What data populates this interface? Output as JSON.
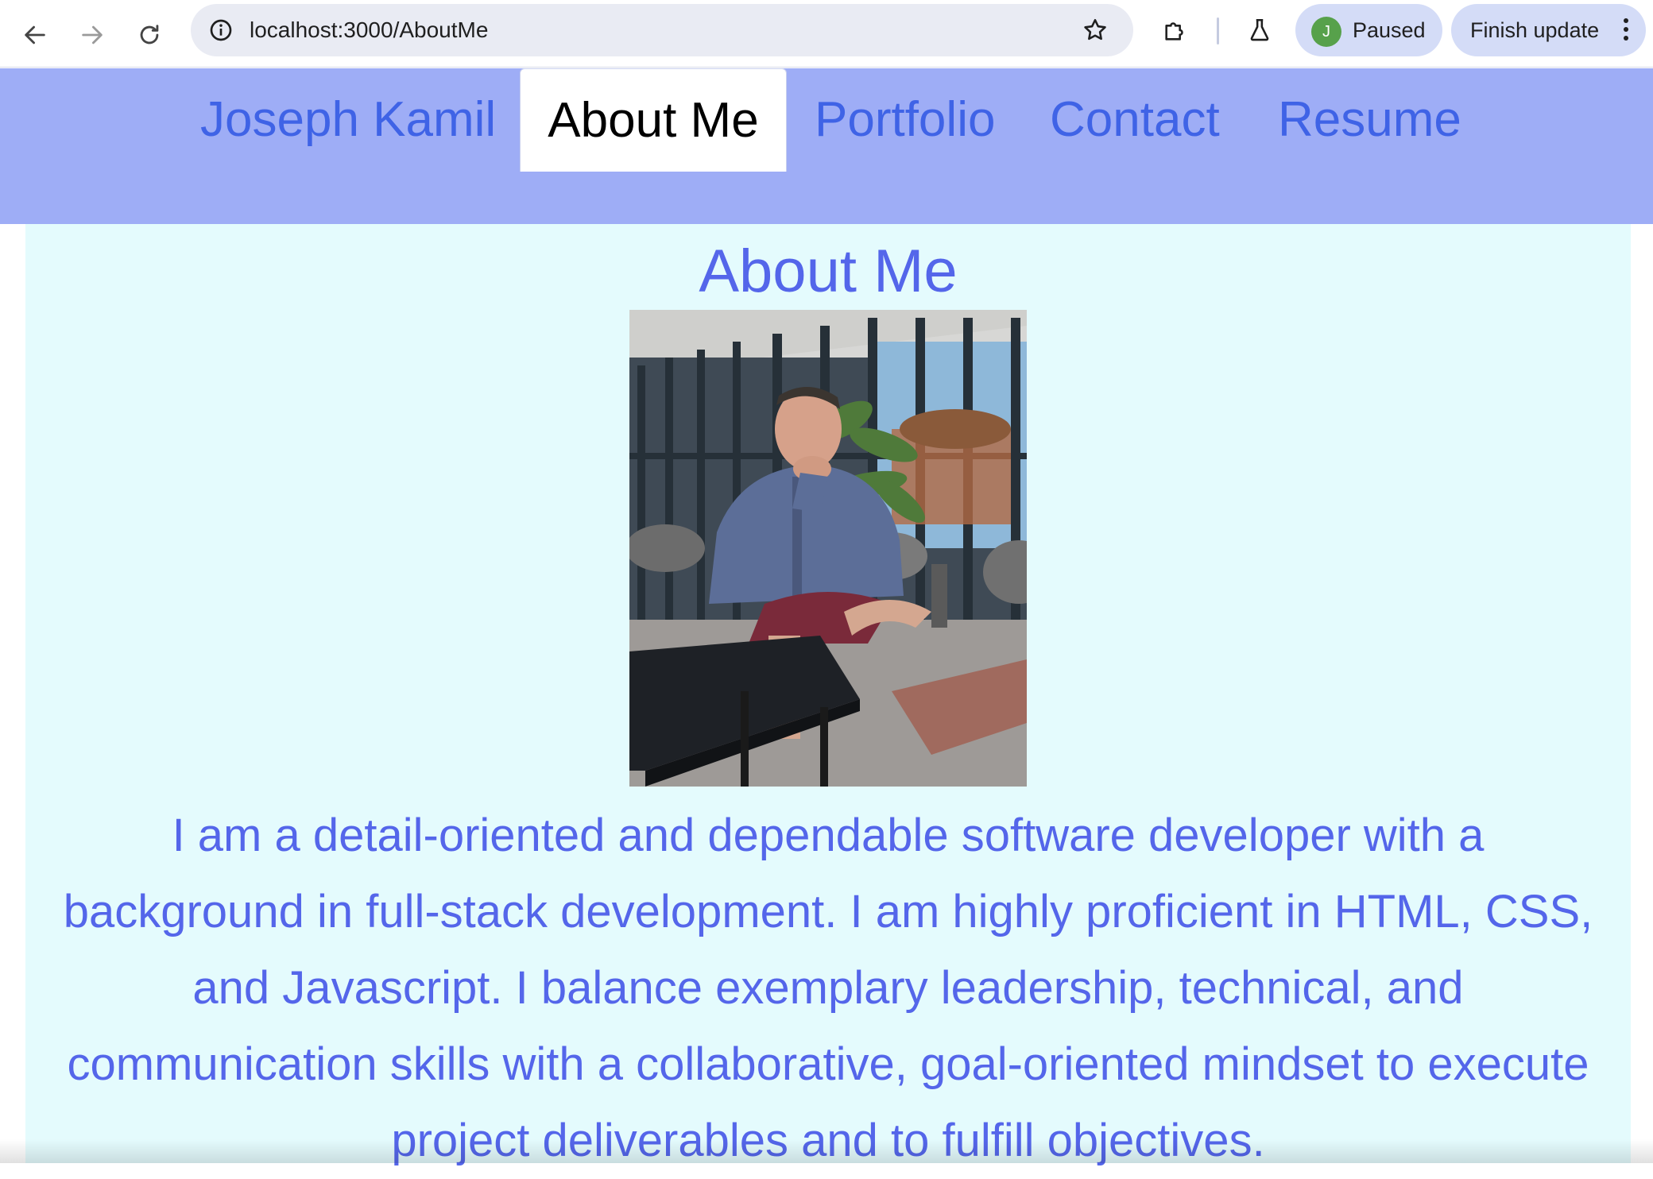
{
  "browser": {
    "url": "localhost:3000/AboutMe",
    "profile_initial": "J",
    "profile_status": "Paused",
    "update_label": "Finish update"
  },
  "nav": {
    "brand": "Joseph Kamil",
    "about": "About Me",
    "portfolio": "Portfolio",
    "contact": "Contact",
    "resume": "Resume"
  },
  "main": {
    "heading": "About Me",
    "bio": "I am a detail-oriented and dependable software developer with a background in full-stack development. I am highly proficient in HTML, CSS, and Javascript. I balance exemplary leadership, technical, and communication skills with a collaborative, goal-oriented mindset to execute project deliverables and to fulfill objectives."
  },
  "colors": {
    "nav_background": "#9eadf6",
    "nav_link": "#3f63e6",
    "content_background": "#e4fbfd",
    "text_accent": "#5466ea"
  }
}
